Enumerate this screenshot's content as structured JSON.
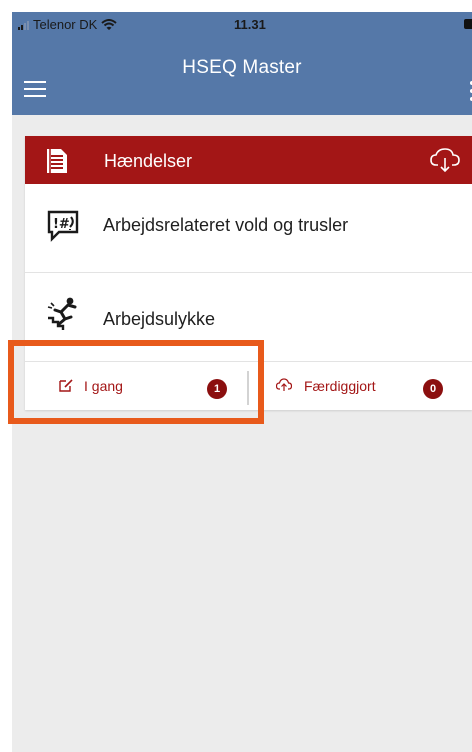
{
  "status_bar": {
    "carrier": "Telenor DK",
    "time": "11.31"
  },
  "app_bar": {
    "title": "HSEQ Master",
    "menu_icon": "hamburger-menu-icon",
    "overflow_icon": "more-vertical-icon"
  },
  "card": {
    "title": "Hændelser",
    "header_icon": "document-list-icon",
    "action_icon": "cloud-download-icon",
    "header_color": "#a31616",
    "items": [
      {
        "label": "Arbejdsrelateret vold og trusler",
        "icon": "speech-bubble-hashtag-icon"
      },
      {
        "label": "Arbejdsulykke",
        "icon": "person-falling-stairs-icon"
      }
    ],
    "footer": {
      "ongoing": {
        "label": "I gang",
        "count": "1",
        "icon": "edit-icon"
      },
      "completed": {
        "label": "Færdiggjort",
        "count": "0",
        "icon": "cloud-upload-icon"
      }
    }
  },
  "colors": {
    "app_bar": "#5578a8",
    "accent_red": "#a31616",
    "badge": "#8b0f0f",
    "highlight": "#e85a1b",
    "background": "#ececec"
  }
}
